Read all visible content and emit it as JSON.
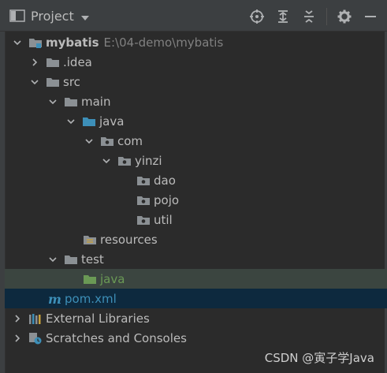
{
  "toolbar": {
    "title": "Project",
    "icons": [
      "select-opened-file-icon",
      "expand-all-icon",
      "collapse-all-icon",
      "gear-icon",
      "hide-icon"
    ]
  },
  "tree": {
    "root": {
      "label": "mybatis",
      "path": "E:\\04-demo\\mybatis"
    },
    "idea": ".idea",
    "src": "src",
    "main": "main",
    "java_main": "java",
    "com": "com",
    "yinzi": "yinzi",
    "dao": "dao",
    "pojo": "pojo",
    "util": "util",
    "resources": "resources",
    "test": "test",
    "java_test": "java",
    "pom": "pom.xml",
    "external_libraries": "External Libraries",
    "scratches": "Scratches and Consoles"
  },
  "watermark": "CSDN @寅子学Java",
  "colors": {
    "background": "#2b2b2b",
    "toolbar": "#3c3f41",
    "selected_row": "#0d293e",
    "test_row": "#3b4540",
    "source_folder": "#3d8fb8",
    "test_folder": "#6a9955",
    "folder": "#8b9094"
  }
}
